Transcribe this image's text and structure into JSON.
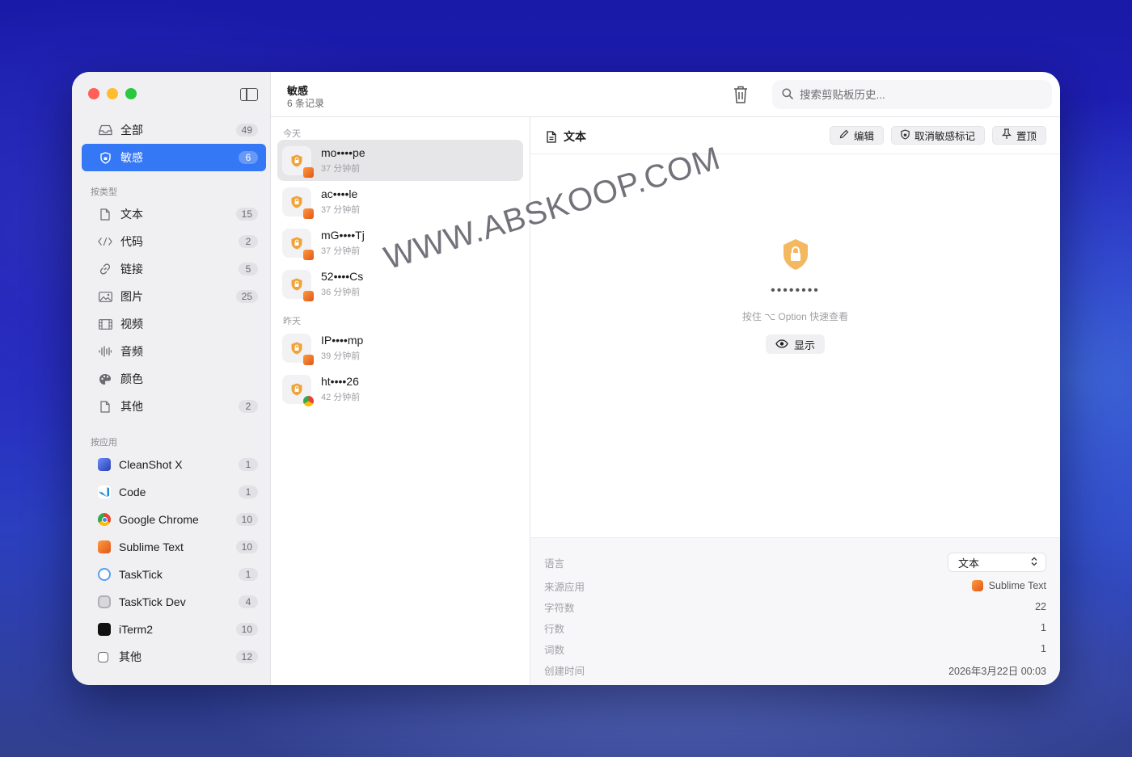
{
  "header": {
    "title": "敏感",
    "subtitle": "6 条记录",
    "search_placeholder": "搜索剪贴板历史..."
  },
  "sidebar": {
    "top_items": [
      {
        "label": "全部",
        "count": "49",
        "icon": "tray-icon"
      },
      {
        "label": "敏感",
        "count": "6",
        "icon": "shield-icon",
        "active": true
      }
    ],
    "type_section_title": "按类型",
    "type_items": [
      {
        "label": "文本",
        "count": "15",
        "icon": "document-icon"
      },
      {
        "label": "代码",
        "count": "2",
        "icon": "code-icon"
      },
      {
        "label": "链接",
        "count": "5",
        "icon": "link-icon"
      },
      {
        "label": "图片",
        "count": "25",
        "icon": "image-icon"
      },
      {
        "label": "视频",
        "count": "",
        "icon": "film-icon"
      },
      {
        "label": "音频",
        "count": "",
        "icon": "waveform-icon"
      },
      {
        "label": "颜色",
        "count": "",
        "icon": "palette-icon"
      },
      {
        "label": "其他",
        "count": "2",
        "icon": "document-icon"
      }
    ],
    "app_section_title": "按应用",
    "app_items": [
      {
        "label": "CleanShot X",
        "count": "1",
        "color": "#3b5bdb"
      },
      {
        "label": "Code",
        "count": "1",
        "color": "#1f8ad2"
      },
      {
        "label": "Google Chrome",
        "count": "10",
        "color": "#e94235"
      },
      {
        "label": "Sublime Text",
        "count": "10",
        "color": "#f28c28"
      },
      {
        "label": "TaskTick",
        "count": "1",
        "color": "#4a90e2"
      },
      {
        "label": "TaskTick Dev",
        "count": "4",
        "color": "#9a9aa0"
      },
      {
        "label": "iTerm2",
        "count": "10",
        "color": "#111111"
      },
      {
        "label": "其他",
        "count": "12",
        "color": "#ffffff"
      }
    ]
  },
  "list": {
    "group_today": "今天",
    "group_yesterday": "昨天",
    "today": [
      {
        "title": "mo••••pe",
        "time": "37 分钟前",
        "app": "sublime"
      },
      {
        "title": "ac••••le",
        "time": "37 分钟前",
        "app": "sublime"
      },
      {
        "title": "mG••••Tj",
        "time": "37 分钟前",
        "app": "sublime"
      },
      {
        "title": "52••••Cs",
        "time": "36 分钟前",
        "app": "sublime"
      }
    ],
    "yesterday": [
      {
        "title": "IP••••mp",
        "time": "39 分钟前",
        "app": "sublime"
      },
      {
        "title": "ht••••26",
        "time": "42 分钟前",
        "app": "chrome"
      }
    ]
  },
  "detail": {
    "title": "文本",
    "edit_label": "编辑",
    "unmark_label": "取消敏感标记",
    "pin_label": "置顶",
    "masked": "••••••••",
    "hint": "按住 ⌥ Option 快速查看",
    "show_label": "显示",
    "meta": {
      "language_label": "语言",
      "language_value": "文本",
      "source_label": "来源应用",
      "source_value": "Sublime Text",
      "chars_label": "字符数",
      "chars_value": "22",
      "lines_label": "行数",
      "lines_value": "1",
      "words_label": "词数",
      "words_value": "1",
      "created_label": "创建时间",
      "created_value": "2026年3月22日 00:03"
    }
  },
  "watermark": "WWW.ABSKOOP.COM",
  "colors": {
    "accent": "#3478f6",
    "sensitive_orange": "#f0a33a"
  }
}
